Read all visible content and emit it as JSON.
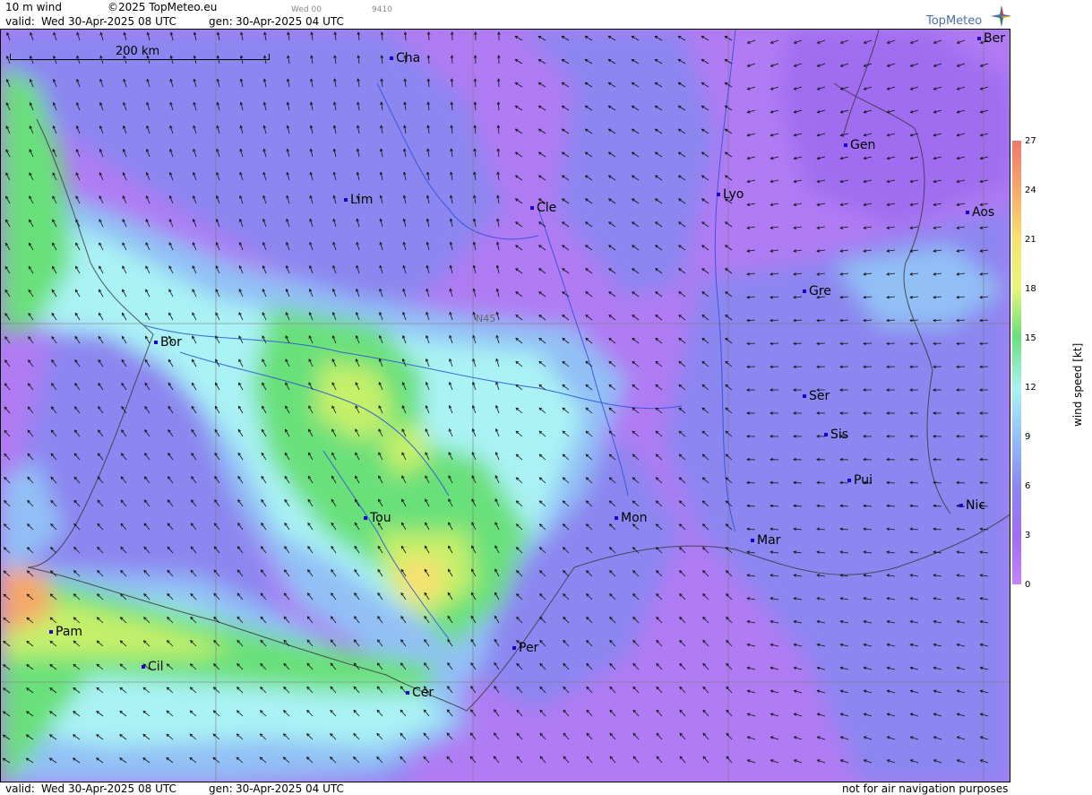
{
  "header": {
    "product": "10 m wind",
    "copyright": "©2025 TopMeteo.eu",
    "day_code": "Wed 00",
    "run_code": "9410",
    "valid_label": "valid:",
    "valid_value": "Wed 30-Apr-2025 08 UTC",
    "gen_label": "gen:",
    "gen_value": "30-Apr-2025 04 UTC"
  },
  "logo": {
    "text": "TopMeteo",
    "icon": "compass-star-icon"
  },
  "map": {
    "scale_label": "200 km",
    "latitude_label": "N45",
    "cities": [
      {
        "name": "Cha"
      },
      {
        "name": "Ber"
      },
      {
        "name": "Gen"
      },
      {
        "name": "Lim"
      },
      {
        "name": "Cle"
      },
      {
        "name": "Lyo"
      },
      {
        "name": "Aos"
      },
      {
        "name": "Gre"
      },
      {
        "name": "Bor"
      },
      {
        "name": "Ser"
      },
      {
        "name": "Sis"
      },
      {
        "name": "Pui"
      },
      {
        "name": "Nic"
      },
      {
        "name": "Mon"
      },
      {
        "name": "Tou"
      },
      {
        "name": "Mar"
      },
      {
        "name": "Pam"
      },
      {
        "name": "Per"
      },
      {
        "name": "Cil"
      },
      {
        "name": "Cer"
      }
    ]
  },
  "legend": {
    "title": "wind speed [kt]",
    "ticks": [
      "27",
      "24",
      "21",
      "18",
      "15",
      "12",
      "9",
      "6",
      "3",
      "0"
    ],
    "colors": [
      "#f0786c",
      "#f5a96a",
      "#f8e16f",
      "#e9f77a",
      "#6ae07a",
      "#aaf2f5",
      "#92c0f5",
      "#8c86f0",
      "#a06df0",
      "#c483f8"
    ]
  },
  "footer": {
    "valid_label": "valid:",
    "valid_value": "Wed 30-Apr-2025 08 UTC",
    "gen_label": "gen:",
    "gen_value": "30-Apr-2025 04 UTC",
    "disclaimer": "not for air navigation purposes"
  }
}
